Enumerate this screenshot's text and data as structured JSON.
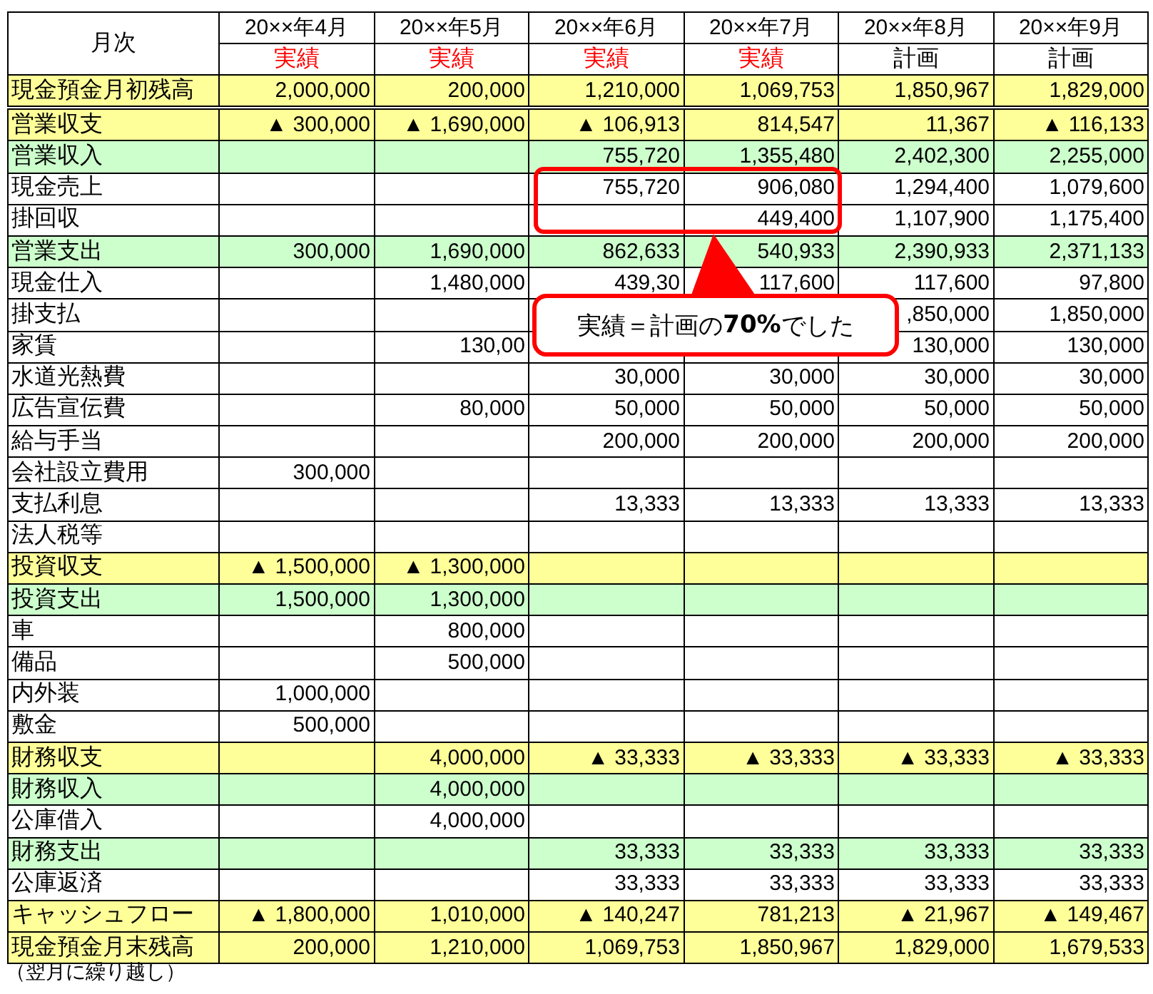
{
  "header": {
    "label": "月次",
    "columns": [
      {
        "month": "20××年4月",
        "status": "実績",
        "kind": "actual"
      },
      {
        "month": "20××年5月",
        "status": "実績",
        "kind": "actual"
      },
      {
        "month": "20××年6月",
        "status": "実績",
        "kind": "actual"
      },
      {
        "month": "20××年7月",
        "status": "実績",
        "kind": "actual"
      },
      {
        "month": "20××年8月",
        "status": "計画",
        "kind": "plan"
      },
      {
        "month": "20××年9月",
        "status": "計画",
        "kind": "plan"
      }
    ]
  },
  "rows": [
    {
      "label": "現金預金月初残高",
      "kind": "total",
      "apr": "2,000,000",
      "may": "200,000",
      "jun": "1,210,000",
      "jul": "1,069,753",
      "aug": "1,850,967",
      "sep": "1,829,000"
    },
    {
      "label": "営業収支",
      "kind": "total",
      "apr": "▲ 300,000",
      "may": "▲ 1,690,000",
      "jun": "▲ 106,913",
      "jul": "814,547",
      "aug": "11,367",
      "sep": "▲ 116,133"
    },
    {
      "label": "営業収入",
      "kind": "subtotal",
      "jun": "755,720",
      "jul": "1,355,480",
      "aug": "2,402,300",
      "sep": "2,255,000"
    },
    {
      "label": "現金売上",
      "kind": "item",
      "jun": "755,720",
      "jul": "906,080",
      "aug": "1,294,400",
      "sep": "1,079,600"
    },
    {
      "label": "掛回収",
      "kind": "item",
      "jul": "449,400",
      "aug": "1,107,900",
      "sep": "1,175,400"
    },
    {
      "label": "営業支出",
      "kind": "subtotal",
      "apr": "300,000",
      "may": "1,690,000",
      "jun": "862,633",
      "jul": "540,933",
      "aug": "2,390,933",
      "sep": "2,371,133"
    },
    {
      "label": "現金仕入",
      "kind": "item",
      "may": "1,480,000",
      "jun": "439,30",
      "jul": "117,600",
      "aug": "117,600",
      "sep": "97,800"
    },
    {
      "label": "掛支払",
      "kind": "item",
      "aug": ",850,000",
      "sep": "1,850,000"
    },
    {
      "label": "家賃",
      "kind": "item",
      "may": "130,00",
      "aug": "130,000",
      "sep": "130,000"
    },
    {
      "label": "水道光熱費",
      "kind": "item",
      "jun": "30,000",
      "jul": "30,000",
      "aug": "30,000",
      "sep": "30,000"
    },
    {
      "label": "広告宣伝費",
      "kind": "item",
      "may": "80,000",
      "jun": "50,000",
      "jul": "50,000",
      "aug": "50,000",
      "sep": "50,000"
    },
    {
      "label": "給与手当",
      "kind": "item",
      "jun": "200,000",
      "jul": "200,000",
      "aug": "200,000",
      "sep": "200,000"
    },
    {
      "label": "会社設立費用",
      "kind": "item",
      "apr": "300,000"
    },
    {
      "label": "支払利息",
      "kind": "item",
      "jun": "13,333",
      "jul": "13,333",
      "aug": "13,333",
      "sep": "13,333"
    },
    {
      "label": "法人税等",
      "kind": "item"
    },
    {
      "label": "投資収支",
      "kind": "total",
      "apr": "▲ 1,500,000",
      "may": "▲ 1,300,000"
    },
    {
      "label": "投資支出",
      "kind": "subtotal",
      "apr": "1,500,000",
      "may": "1,300,000"
    },
    {
      "label": "車",
      "kind": "item",
      "may": "800,000"
    },
    {
      "label": "備品",
      "kind": "item",
      "may": "500,000"
    },
    {
      "label": "内外装",
      "kind": "item",
      "apr": "1,000,000"
    },
    {
      "label": "敷金",
      "kind": "item",
      "apr": "500,000"
    },
    {
      "label": "財務収支",
      "kind": "total",
      "may": "4,000,000",
      "jun": "▲ 33,333",
      "jul": "▲ 33,333",
      "aug": "▲ 33,333",
      "sep": "▲ 33,333"
    },
    {
      "label": "財務収入",
      "kind": "subtotal",
      "may": "4,000,000"
    },
    {
      "label": "公庫借入",
      "kind": "item",
      "may": "4,000,000"
    },
    {
      "label": "財務支出",
      "kind": "subtotal",
      "jun": "33,333",
      "jul": "33,333",
      "aug": "33,333",
      "sep": "33,333"
    },
    {
      "label": "公庫返済",
      "kind": "item",
      "jun": "33,333",
      "jul": "33,333",
      "aug": "33,333",
      "sep": "33,333"
    },
    {
      "label": "キャッシュフロー",
      "kind": "total",
      "apr": "▲ 1,800,000",
      "may": "1,010,000",
      "jun": "▲ 140,247",
      "jul": "781,213",
      "aug": "▲ 21,967",
      "sep": "▲ 149,467"
    },
    {
      "label": "現金預金月末残高",
      "kind": "total",
      "apr": "200,000",
      "may": "1,210,000",
      "jun": "1,069,753",
      "jul": "1,850,967",
      "aug": "1,829,000",
      "sep": "1,679,533"
    }
  ],
  "footnote": "（翌月に繰り越し）",
  "callout": "実績＝計画の**70%**でした"
}
